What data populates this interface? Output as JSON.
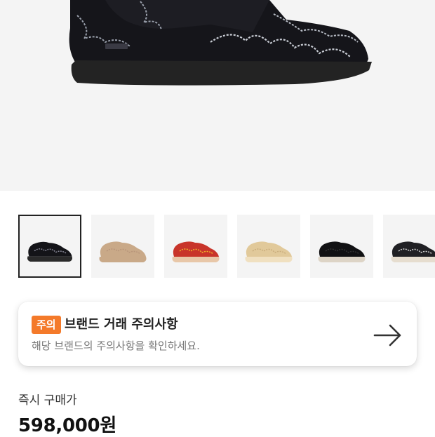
{
  "product": {
    "image_name": "black-suede-wallabee-boot-with-flame-embroidery",
    "thumbnails": [
      {
        "name": "black-flame-wallabee",
        "body": "#141418",
        "sole": "#2a2a2a",
        "accent": "#8a8a9a",
        "active": true
      },
      {
        "name": "tan-suede-wallabee",
        "body": "#c9a988",
        "sole": "#c9a988",
        "accent": "#b8957a",
        "active": false
      },
      {
        "name": "red-yellow-flame-wallabee",
        "body": "#c8342a",
        "sole": "#e8c7a8",
        "accent": "#f0b42a",
        "active": false
      },
      {
        "name": "woven-beige-wallabee",
        "body": "#e1c99a",
        "sole": "#f0e0c0",
        "accent": "#c9ad7c",
        "active": false
      },
      {
        "name": "black-woven-wallabee",
        "body": "#111113",
        "sole": "#ddd4c6",
        "accent": "#333",
        "active": false
      },
      {
        "name": "black-paisley-wallabee",
        "body": "#202024",
        "sole": "#e6ddcf",
        "accent": "#d9d9d9",
        "active": false
      }
    ]
  },
  "notice": {
    "badge": "주의",
    "title": "브랜드 거래 주의사항",
    "subtitle": "해당 브랜드의 주의사항을 확인하세요.",
    "badge_color": "#f47a2a"
  },
  "purchase": {
    "label": "즉시 구매가",
    "price": "598,000원"
  }
}
